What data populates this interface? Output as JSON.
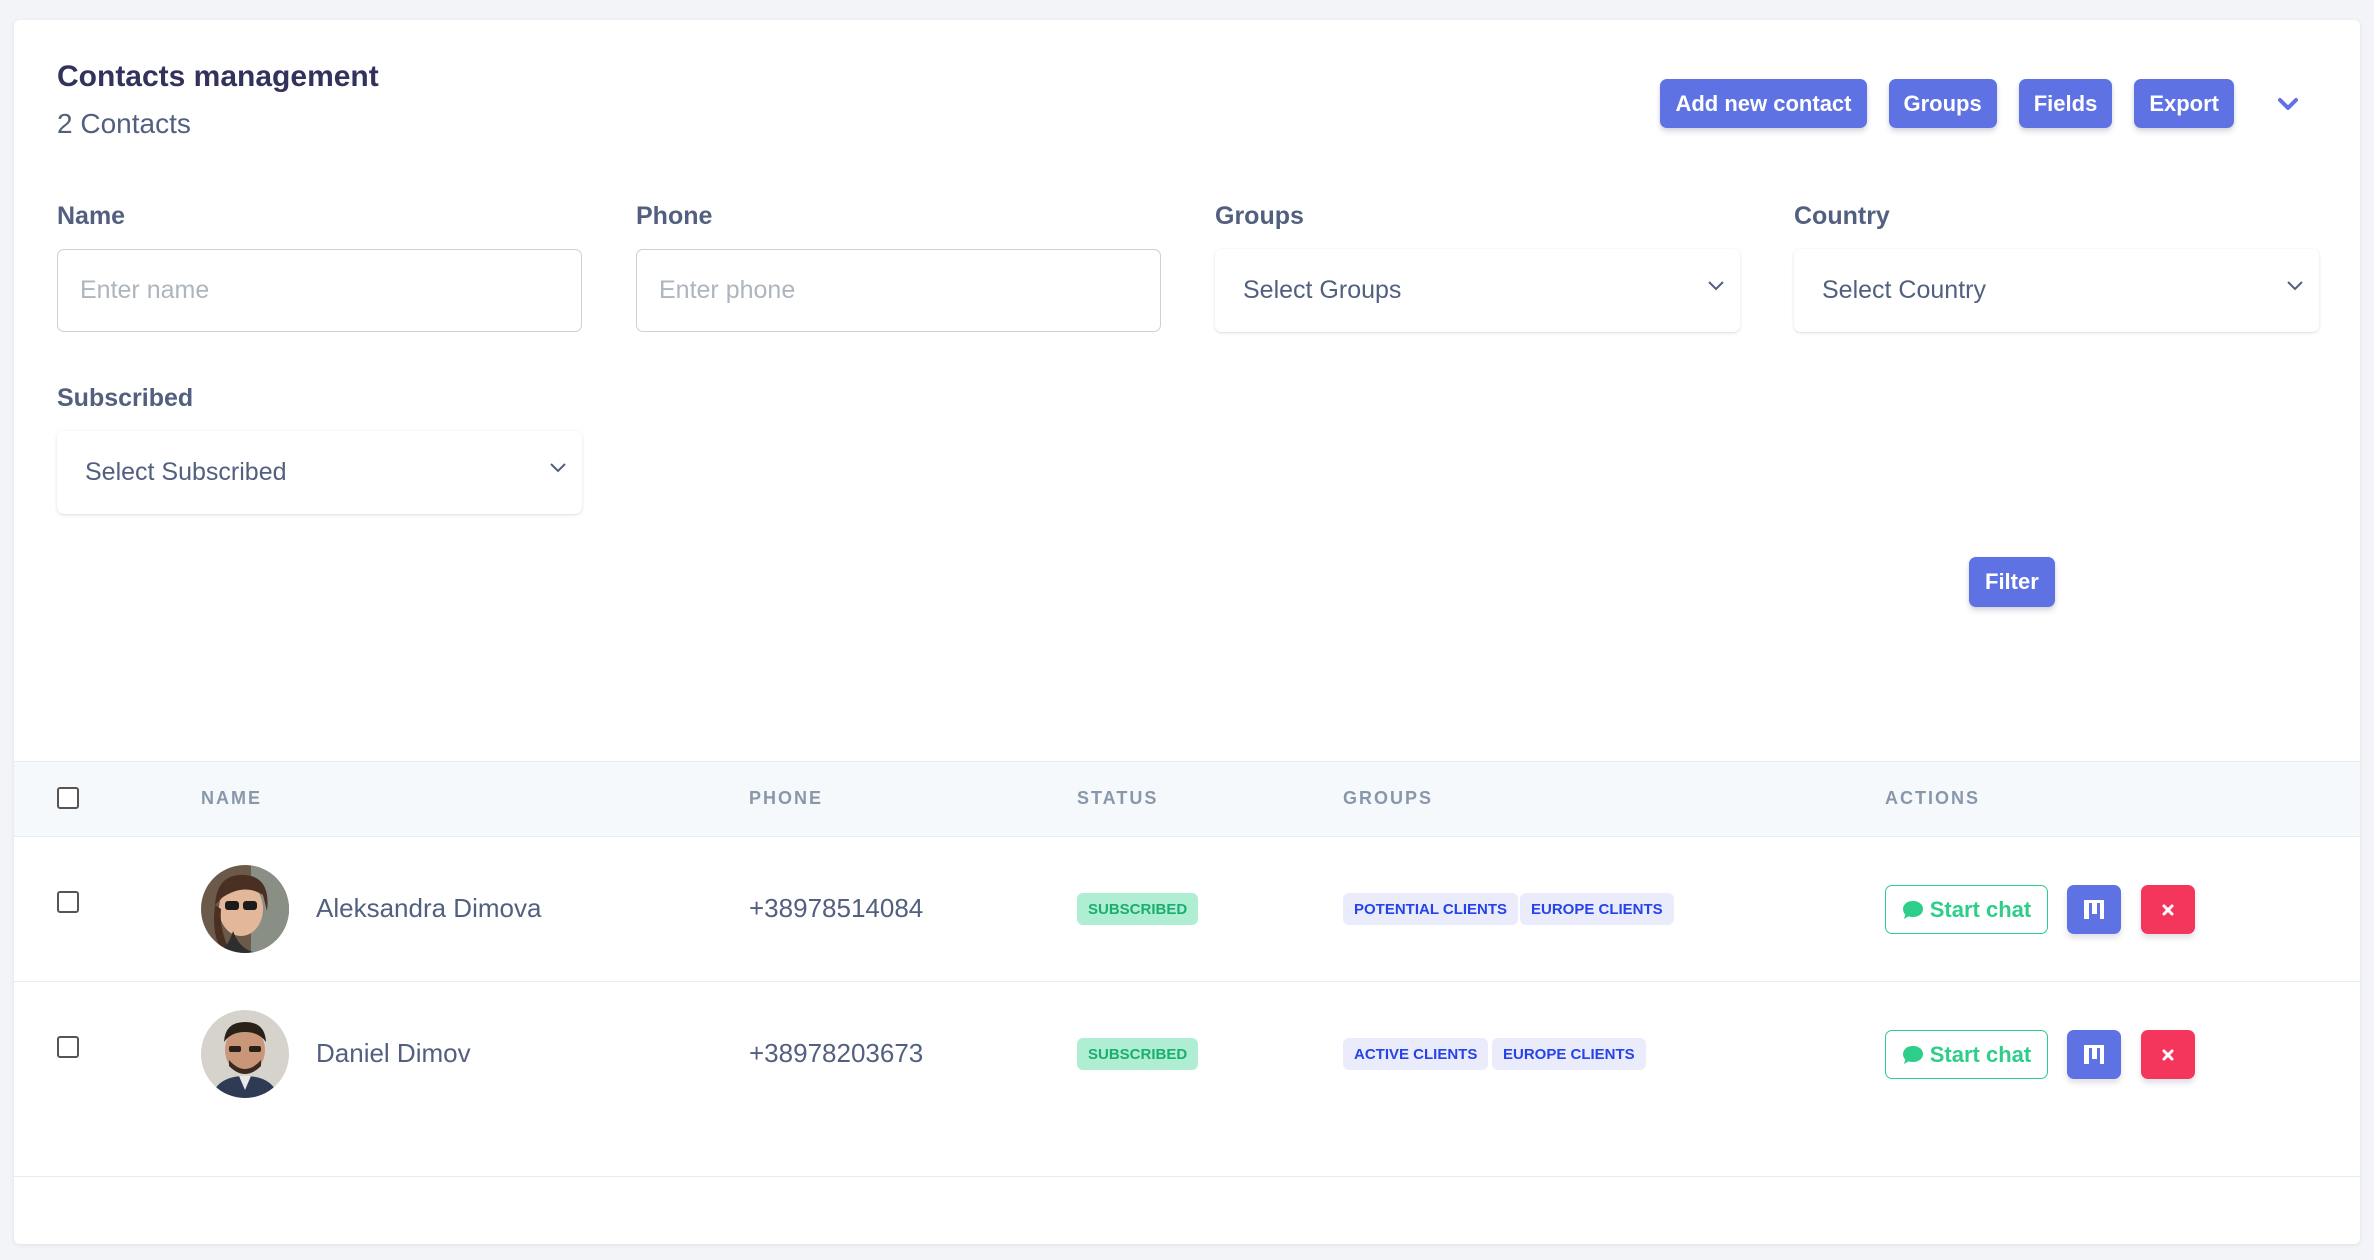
{
  "header": {
    "title": "Contacts management",
    "subtitle": "2 Contacts",
    "buttons": {
      "add_contact": "Add new contact",
      "groups": "Groups",
      "fields": "Fields",
      "export": "Export"
    }
  },
  "filters": {
    "name": {
      "label": "Name",
      "placeholder": "Enter name",
      "value": ""
    },
    "phone": {
      "label": "Phone",
      "placeholder": "Enter phone",
      "value": ""
    },
    "groups": {
      "label": "Groups",
      "selected": "Select Groups"
    },
    "country": {
      "label": "Country",
      "selected": "Select Country"
    },
    "subscribed": {
      "label": "Subscribed",
      "selected": "Select Subscribed"
    },
    "filter_button": "Filter"
  },
  "table": {
    "columns": [
      "NAME",
      "PHONE",
      "STATUS",
      "GROUPS",
      "ACTIONS"
    ],
    "rows": [
      {
        "name": "Aleksandra Dimova",
        "phone": "+38978514084",
        "status": "SUBSCRIBED",
        "groups": [
          "POTENTIAL CLIENTS",
          "EUROPE CLIENTS"
        ],
        "chat_label": "Start chat"
      },
      {
        "name": "Daniel Dimov",
        "phone": "+38978203673",
        "status": "SUBSCRIBED",
        "groups": [
          "ACTIVE CLIENTS",
          "EUROPE CLIENTS"
        ],
        "chat_label": "Start chat"
      }
    ]
  },
  "colors": {
    "primary": "#5e72e4",
    "success": "#2dce89",
    "danger": "#f5365c"
  },
  "icons": {
    "collapse": "chevron-down-icon",
    "chat": "chat-bubble-icon",
    "edit": "edit-icon",
    "delete": "close-icon"
  }
}
